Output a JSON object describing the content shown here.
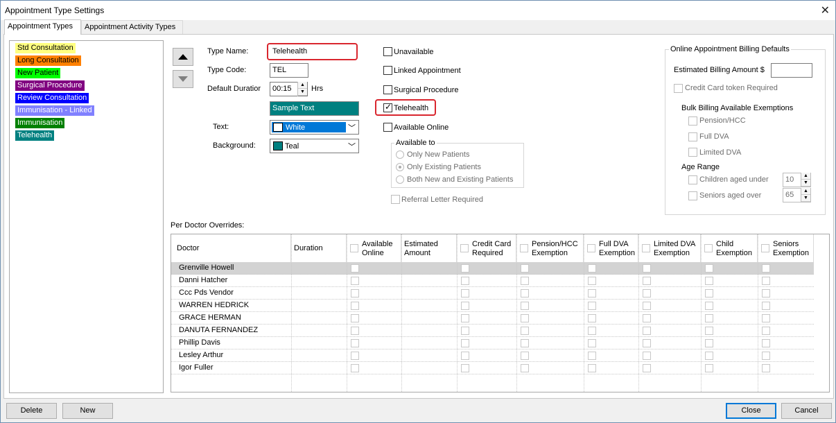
{
  "window": {
    "title": "Appointment Type Settings"
  },
  "tabs": [
    {
      "label": "Appointment Types",
      "active": true
    },
    {
      "label": "Appointment Activity Types",
      "active": false
    }
  ],
  "appointment_types": [
    {
      "label": "Std Consultation",
      "bg": "#ffff80",
      "fg": "#000000"
    },
    {
      "label": "Long Consultation",
      "bg": "#ff8000",
      "fg": "#000000"
    },
    {
      "label": "New Patient",
      "bg": "#00ff00",
      "fg": "#000000"
    },
    {
      "label": "Surgical Procedure",
      "bg": "#800080",
      "fg": "#ffffff"
    },
    {
      "label": "Review Consultation",
      "bg": "#0000ff",
      "fg": "#ffffff"
    },
    {
      "label": "Immunisation - Linked",
      "bg": "#8080ff",
      "fg": "#ffffff"
    },
    {
      "label": "Immunisation",
      "bg": "#008000",
      "fg": "#ffffff"
    },
    {
      "label": "Telehealth",
      "bg": "#008080",
      "fg": "#ffffff"
    }
  ],
  "form": {
    "type_name_label": "Type Name:",
    "type_name_value": "Telehealth",
    "type_code_label": "Type Code:",
    "type_code_value": "TEL",
    "default_duration_label": "Default Duratior",
    "default_duration_value": "00:15",
    "duration_unit": "Hrs",
    "sample_text": "Sample Text",
    "sample_bg": "#008080",
    "text_label": "Text:",
    "text_color_value": "White",
    "text_color_swatch": "#ffffff",
    "background_label": "Background:",
    "background_value": "Teal",
    "background_swatch": "#008080"
  },
  "options": {
    "unavailable": {
      "label": "Unavailable",
      "checked": false
    },
    "linked_appointment": {
      "label": "Linked Appointment",
      "checked": false
    },
    "surgical_procedure": {
      "label": "Surgical Procedure",
      "checked": false
    },
    "telehealth": {
      "label": "Telehealth",
      "checked": true
    },
    "available_online": {
      "label": "Available Online",
      "checked": false
    },
    "available_to_title": "Available to",
    "available_to": [
      {
        "label": "Only New Patients",
        "selected": false
      },
      {
        "label": "Only Existing Patients",
        "selected": true
      },
      {
        "label": "Both New and Existing Patients",
        "selected": false
      }
    ],
    "referral_letter": {
      "label": "Referral Letter Required",
      "checked": false
    }
  },
  "billing": {
    "title": "Online Appointment Billing Defaults",
    "estimated_amount_label": "Estimated Billing Amount $",
    "estimated_amount_value": "",
    "credit_card_label": "Credit Card token Required",
    "exemptions_title": "Bulk Billing Available Exemptions",
    "pension_label": "Pension/HCC",
    "full_dva_label": "Full DVA",
    "limited_dva_label": "Limited DVA",
    "age_range_title": "Age Range",
    "children_label": "Children aged under",
    "children_value": "10",
    "seniors_label": "Seniors aged over",
    "seniors_value": "65"
  },
  "overrides": {
    "title": "Per Doctor Overrides:",
    "columns": {
      "doctor": "Doctor",
      "duration": "Duration",
      "available_online_1": "Available",
      "available_online_2": "Online",
      "estimated_1": "Estimated",
      "estimated_2": "Amount",
      "credit_1": "Credit Card",
      "credit_2": "Required",
      "pension_1": "Pension/HCC",
      "pension_2": "Exemption",
      "fulldva_1": "Full DVA",
      "fulldva_2": "Exemption",
      "limiteddva_1": "Limited DVA",
      "limiteddva_2": "Exemption",
      "child_1": "Child",
      "child_2": "Exemption",
      "seniors_1": "Seniors",
      "seniors_2": "Exemption"
    },
    "doctors": [
      "Grenville Howell",
      "Danni Hatcher",
      "Ccc Pds Vendor",
      "WARREN HEDRICK",
      "GRACE HERMAN",
      "DANUTA FERNANDEZ",
      "Phillip Davis",
      "Lesley Arthur",
      "Igor Fuller"
    ]
  },
  "buttons": {
    "delete": "Delete",
    "new": "New",
    "close": "Close",
    "cancel": "Cancel"
  }
}
